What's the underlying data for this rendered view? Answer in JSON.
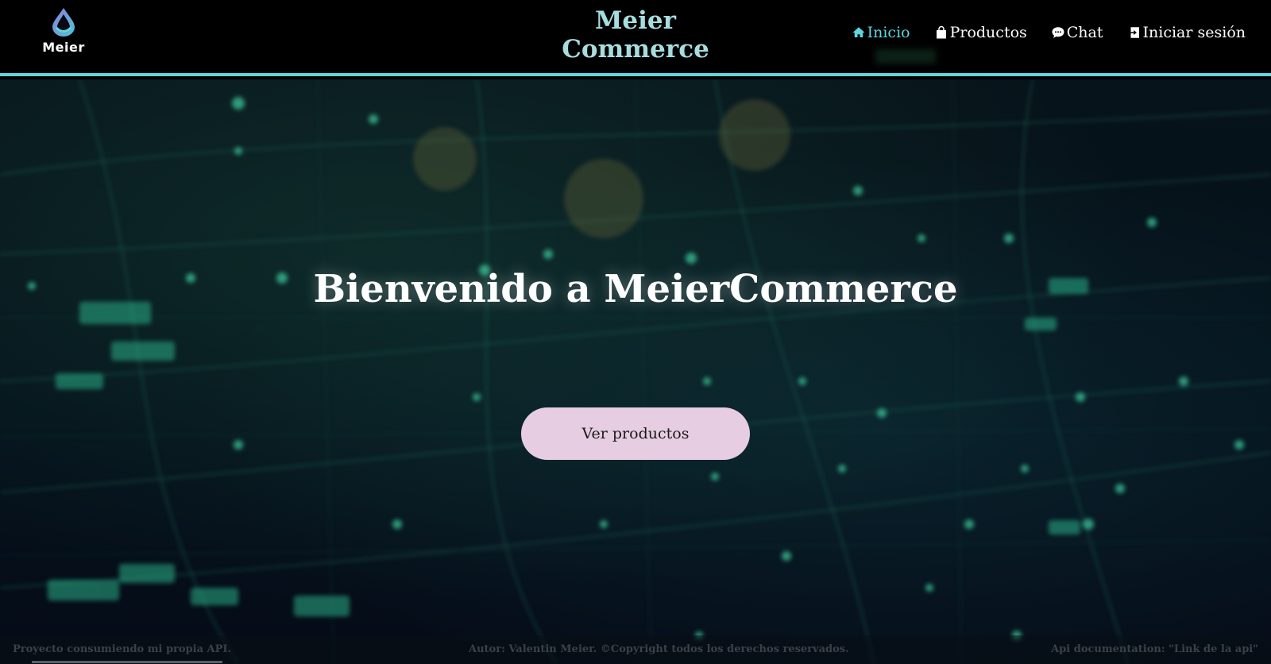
{
  "header": {
    "logo": {
      "text": "Meier",
      "icon": "drop-logo-icon"
    },
    "brand": {
      "line1": "Meier",
      "line2": "Commerce"
    },
    "nav": [
      {
        "label": "Inicio",
        "icon": "home-icon",
        "active": true
      },
      {
        "label": "Productos",
        "icon": "shopping-bag-icon",
        "active": false
      },
      {
        "label": "Chat",
        "icon": "chat-icon",
        "active": false
      },
      {
        "label": "Iniciar sesión",
        "icon": "login-icon",
        "active": false
      }
    ]
  },
  "hero": {
    "title": "Bienvenido a MeierCommerce",
    "cta_label": "Ver productos"
  },
  "footer": {
    "left": "Proyecto consumiendo mi propia API.",
    "center": "Autor: Valentin Meier. ©Copyright todos los derechos reservados.",
    "right": "Api documentation: \"Link de la api\""
  },
  "colors": {
    "accent": "#5fd7dd",
    "brand_text": "#a8dde0",
    "cta_bg": "#e6cde1",
    "header_bg": "#000000"
  }
}
